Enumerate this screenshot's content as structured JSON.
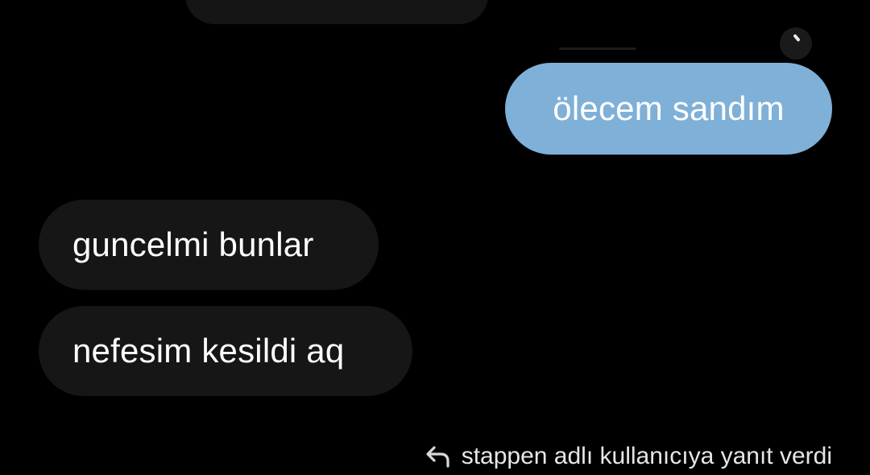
{
  "conversation": {
    "messages": [
      {
        "direction": "outgoing",
        "text": "ölecem sandım"
      },
      {
        "direction": "incoming",
        "text": "guncelmi bunlar"
      },
      {
        "direction": "incoming",
        "text": "nefesim kesildi aq"
      }
    ],
    "reply_note": {
      "icon": "reply-arrow-icon",
      "text": "stappen adlı kullanıcıya yanıt verdi"
    }
  },
  "colors": {
    "background": "#000000",
    "outgoing_bubble": "#7fb0d8",
    "incoming_bubble": "#161616",
    "text": "#ffffff"
  }
}
